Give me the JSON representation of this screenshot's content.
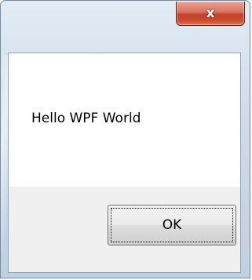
{
  "window": {
    "close_icon": "close-icon",
    "close_glyph": "x"
  },
  "dialog": {
    "message": "Hello WPF World",
    "ok_label": "OK"
  },
  "colors": {
    "close_button": "#c94a2f",
    "frame": "#bfd0e3",
    "client_bg": "#ffffff",
    "button_strip_bg": "#f0f0f0"
  }
}
